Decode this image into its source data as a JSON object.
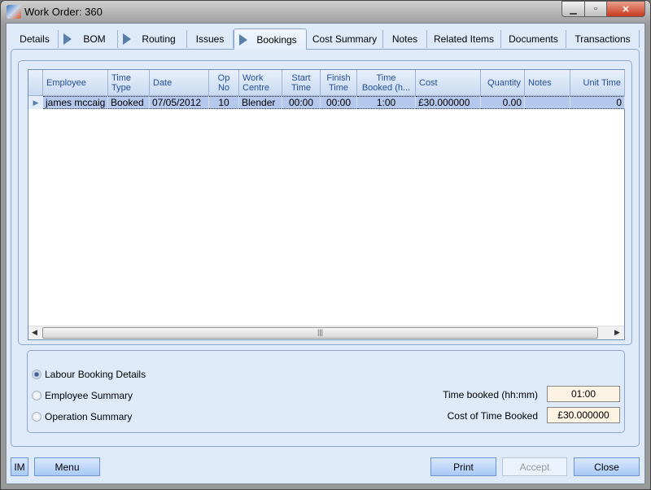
{
  "window": {
    "title": "Work Order: 360"
  },
  "tabs": [
    {
      "label": "Details"
    },
    {
      "label": "BOM"
    },
    {
      "label": "Routing"
    },
    {
      "label": "Issues"
    },
    {
      "label": "Bookings"
    },
    {
      "label": "Cost Summary"
    },
    {
      "label": "Notes"
    },
    {
      "label": "Related Items"
    },
    {
      "label": "Documents"
    },
    {
      "label": "Transactions"
    }
  ],
  "grid": {
    "columns": [
      "Employee",
      "Time Type",
      "Date",
      "Op No",
      "Work Centre",
      "Start Time",
      "Finish Time",
      "Time Booked (h...",
      "Cost",
      "Quantity",
      "Notes",
      "Unit Time"
    ],
    "rows": [
      [
        "james mccaig",
        "Booked",
        "07/05/2012",
        "10",
        "Blender",
        "00:00",
        "00:00",
        "1:00",
        "£30.000000",
        "0.00",
        "",
        "0"
      ]
    ]
  },
  "options": {
    "labour": "Labour Booking Details",
    "employee": "Employee Summary",
    "operation": "Operation Summary",
    "selected": "labour"
  },
  "summary": {
    "time_label": "Time booked (hh:mm)",
    "time_value": "01:00",
    "cost_label": "Cost of Time Booked",
    "cost_value": "£30.000000"
  },
  "buttons": {
    "im": "IM",
    "menu": "Menu",
    "print": "Print",
    "accept": "Accept",
    "close": "Close"
  }
}
